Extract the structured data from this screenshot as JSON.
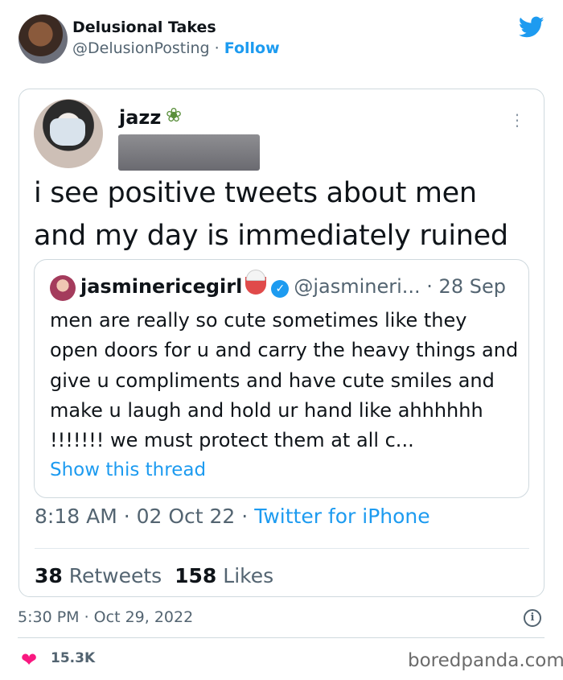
{
  "embed": {
    "author_name": "Delusional Takes",
    "author_handle": "@DelusionPosting",
    "separator": "·",
    "follow_label": "Follow",
    "timestamp": "5:30 PM · Oct 29, 2022",
    "likes_count": "15.3K",
    "watermark": "boredpanda.com",
    "accent_color": "#1d9bf0",
    "heart_color": "#f91880"
  },
  "screenshot_tweet": {
    "author_name": "jazz",
    "name_emoji_icon": "potted-plant-icon",
    "text": "i see positive tweets about men and my day is immediately ruined",
    "timestamp": "8:18 AM · 02 Oct 22 · ",
    "source": "Twitter for iPhone",
    "retweets_count": "38",
    "retweets_label": " Retweets",
    "likes_count": "158",
    "likes_label": " Likes"
  },
  "quoted_tweet": {
    "author_name": "jasminericegirl",
    "name_emoji_icon": "rice-bowl-icon",
    "handle": "@jasmineri...",
    "date": " · 28 Sep",
    "text": "men are really so cute sometimes like they open doors for u and carry the heavy things and give u compliments and have cute smiles and make u laugh and hold ur hand like ahhhhhh !!!!!!! we must protect them at all c...",
    "show_thread_label": "Show this thread"
  }
}
